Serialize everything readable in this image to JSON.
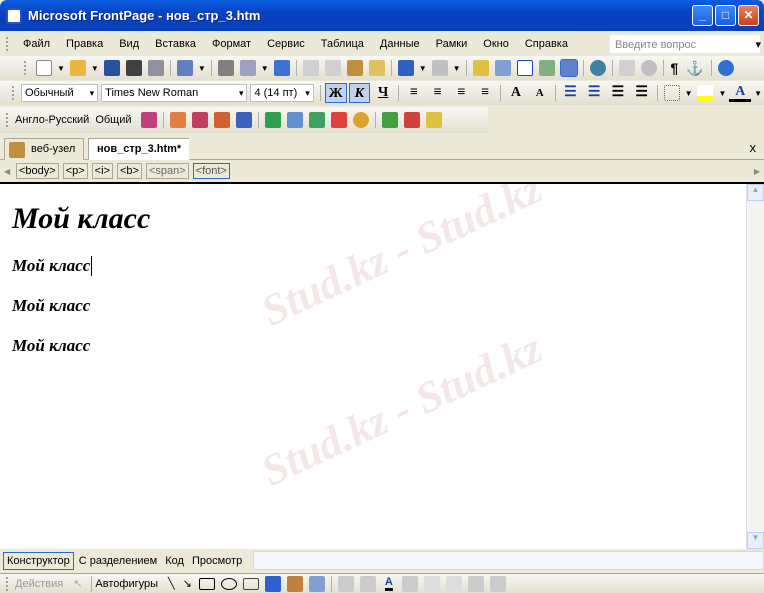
{
  "window": {
    "title": "Microsoft FrontPage - нов_стр_3.htm",
    "min": "_",
    "max": "□",
    "close": "✕"
  },
  "menu": [
    "Файл",
    "Правка",
    "Вид",
    "Вставка",
    "Формат",
    "Сервис",
    "Таблица",
    "Данные",
    "Рамки",
    "Окно",
    "Справка"
  ],
  "ask_placeholder": "Введите вопрос",
  "format": {
    "style": "Обычный",
    "font": "Times New Roman",
    "size": "4  (14 пт)",
    "bold": "Ж",
    "italic": "К",
    "underline": "Ч"
  },
  "toolbar3": {
    "dict": "Англо-Русский",
    "general": "Общий"
  },
  "tabs": {
    "site": "веб-узел",
    "page": "нов_стр_3.htm*",
    "close": "x"
  },
  "tags": [
    "<body>",
    "<p>",
    "<i>",
    "<b>",
    "<span>",
    "<font>"
  ],
  "content": {
    "heading": "Мой класс",
    "lines": [
      "Мой класс",
      "Мой класс",
      "Мой класс"
    ]
  },
  "views": [
    "Конструктор",
    "С разделением",
    "Код",
    "Просмотр"
  ],
  "drawing": {
    "actions": "Действия",
    "autoshapes": "Автофигуры"
  },
  "watermark": "Stud.kz - Stud.kz"
}
